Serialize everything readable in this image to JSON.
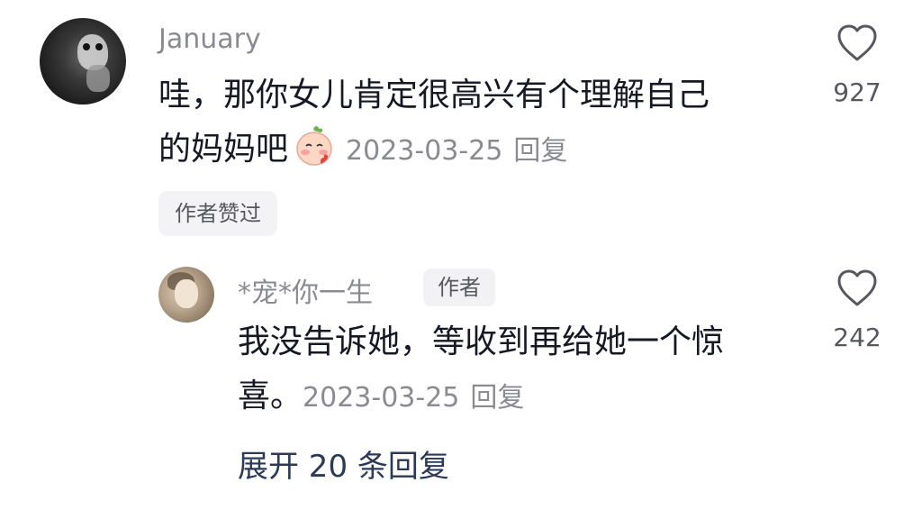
{
  "comment": {
    "username": "January",
    "text_line1": "哇，那你女儿肯定很高兴有个理解自己",
    "text_line2": "的妈妈吧",
    "emoji": "shy-peach-emoji",
    "date": "2023-03-25",
    "reply_label": "回复",
    "liked_badge": "作者赞过",
    "like_count": "927"
  },
  "reply": {
    "username": "*宠*你一生",
    "author_tag": "作者",
    "text_line1": "我没告诉她，等收到再给她一个惊",
    "text_line2": "喜。",
    "date": "2023-03-25",
    "reply_label": "回复",
    "like_count": "242"
  },
  "expand": {
    "label": "展开 20 条回复"
  },
  "icons": {
    "like": "heart-outline-icon"
  },
  "colors": {
    "primary_text": "#161823",
    "secondary_text": "#8a8b91",
    "link_text": "#2b3a57",
    "badge_bg": "#f2f2f4"
  }
}
